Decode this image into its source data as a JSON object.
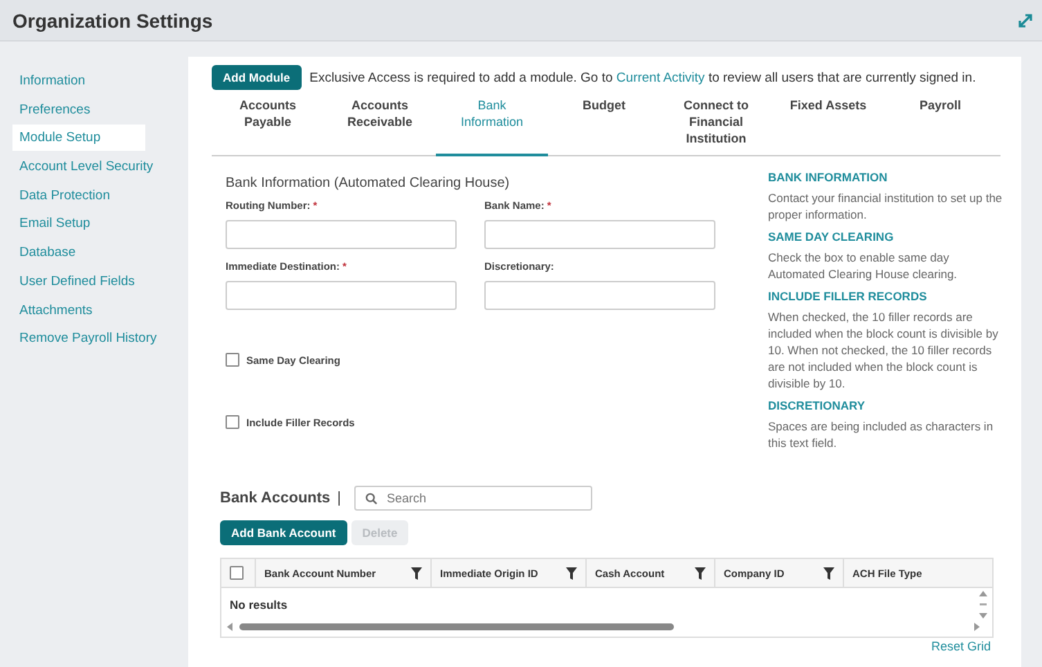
{
  "header": {
    "title": "Organization Settings"
  },
  "sidebar": {
    "items": [
      {
        "label": "Information",
        "selected": false
      },
      {
        "label": "Preferences",
        "selected": false
      },
      {
        "label": "Module Setup",
        "selected": true
      },
      {
        "label": "Account Level Security",
        "selected": false
      },
      {
        "label": "Data Protection",
        "selected": false
      },
      {
        "label": "Email Setup",
        "selected": false
      },
      {
        "label": "Database",
        "selected": false
      },
      {
        "label": "User Defined Fields",
        "selected": false
      },
      {
        "label": "Attachments",
        "selected": false
      },
      {
        "label": "Remove Payroll History",
        "selected": false
      }
    ]
  },
  "notice": {
    "button": "Add Module",
    "text_before": "Exclusive Access is required to add a module. Go to",
    "link": "Current Activity",
    "text_after": "to review all users that are currently signed in."
  },
  "tabs": [
    {
      "label": "Accounts Payable",
      "selected": false
    },
    {
      "label": "Accounts Receivable",
      "selected": false
    },
    {
      "label": "Bank Information",
      "selected": true
    },
    {
      "label": "Budget",
      "selected": false
    },
    {
      "label": "Connect to Financial Institution",
      "selected": false
    },
    {
      "label": "Fixed Assets",
      "selected": false
    },
    {
      "label": "Payroll",
      "selected": false
    }
  ],
  "form": {
    "title": "Bank Information (Automated Clearing House)",
    "fields": [
      {
        "label": "Routing Number:",
        "required_mark": "*"
      },
      {
        "label": "Bank Name:",
        "required_mark": "*"
      },
      {
        "label": "Immediate Destination:",
        "required_mark": "*"
      },
      {
        "label": "Discretionary:"
      }
    ],
    "checkboxes": [
      {
        "label": "Same Day Clearing",
        "checked": false
      },
      {
        "label": "Include Filler Records",
        "checked": false
      }
    ]
  },
  "help": [
    {
      "heading": "BANK INFORMATION",
      "text": "Contact your financial institution to set up the proper information."
    },
    {
      "heading": "SAME DAY CLEARING",
      "text": "Check the box to enable same day Automated Clearing House clearing."
    },
    {
      "heading": "INCLUDE FILLER RECORDS",
      "text": "When checked, the 10 filler records are included when the block count is divisible by 10. When not checked, the 10 filler records are not included when the block count is divisible by 10."
    },
    {
      "heading": "DISCRETIONARY",
      "text": "Spaces are being included as characters in this text field."
    }
  ],
  "bank_accounts": {
    "title": "Bank Accounts",
    "separator": "|",
    "search": {
      "placeholder": "Search"
    },
    "buttons": [
      {
        "label": "Add Bank Account",
        "disabled": false
      },
      {
        "label": "Delete",
        "disabled": true
      }
    ],
    "table": {
      "select_all_checked": false,
      "columns": [
        {
          "label": "Bank Account Number",
          "filter": true
        },
        {
          "label": "Immediate Origin ID",
          "filter": true
        },
        {
          "label": "Cash Account",
          "filter": true
        },
        {
          "label": "Company ID",
          "filter": true
        },
        {
          "label": "ACH File Type",
          "filter": false
        }
      ],
      "empty": "No results"
    },
    "reset": "Reset Grid"
  }
}
